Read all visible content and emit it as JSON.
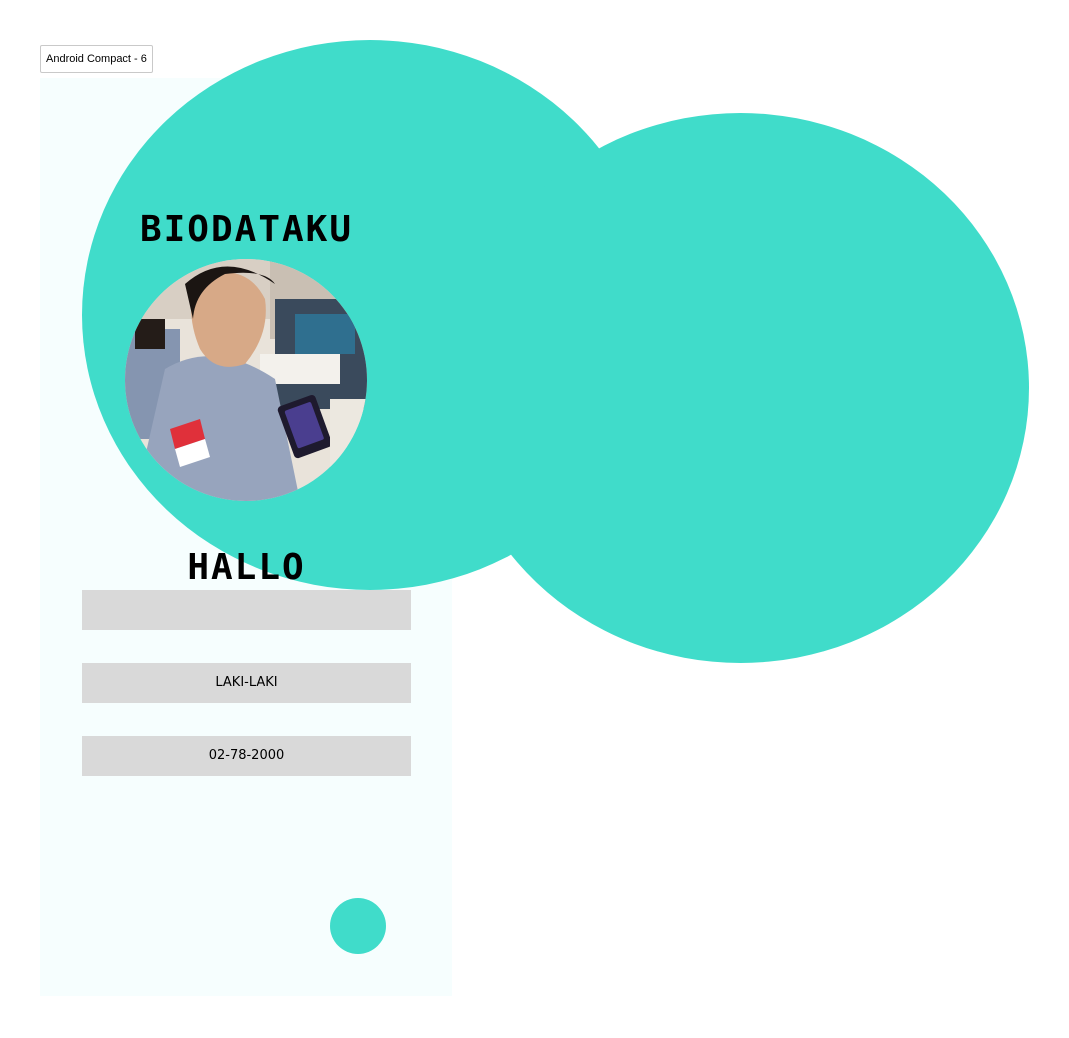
{
  "frame": {
    "label": "Android Compact - 6"
  },
  "colors": {
    "accent": "#40dcca",
    "frame_background": "#f6fefe",
    "field_background": "#d9d9d9",
    "text": "#000000"
  },
  "header": {
    "title": "BIODATAKU"
  },
  "profile": {
    "photo_icon": "profile-photo"
  },
  "greeting": {
    "text": "HALLO"
  },
  "fields": {
    "name": "",
    "gender": "LAKI-LAKI",
    "birth_date": "02-78-2000"
  },
  "fab": {
    "icon": "circle-button"
  }
}
